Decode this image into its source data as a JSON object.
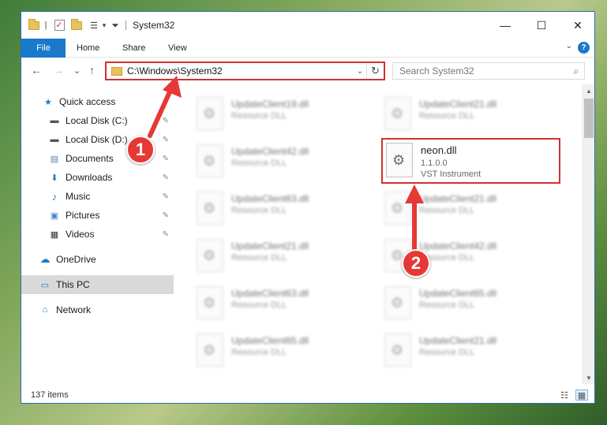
{
  "window": {
    "title": "System32",
    "controls": {
      "minimize": "—",
      "maximize": "☐",
      "close": "✕"
    }
  },
  "quick_access_toolbar": {
    "separator": "|",
    "dropdown": "▾"
  },
  "ribbon": {
    "tabs": [
      "File",
      "Home",
      "Share",
      "View"
    ],
    "expand": "⌄",
    "help": "?"
  },
  "nav_buttons": {
    "back": "←",
    "forward": "→",
    "recent": "⌄",
    "up": "↑"
  },
  "address": {
    "path": "C:\\Windows\\System32",
    "dropdown": "⌄",
    "refresh": "↻"
  },
  "search": {
    "placeholder": "Search System32",
    "icon": "⌕"
  },
  "navigation": {
    "items": [
      {
        "label": "Quick access",
        "icon": "★",
        "pinned": false
      },
      {
        "label": "Local Disk (C:)",
        "icon": "▬",
        "pinned": true
      },
      {
        "label": "Local Disk (D:)",
        "icon": "▬",
        "pinned": true
      },
      {
        "label": "Documents",
        "icon": "▤",
        "pinned": true
      },
      {
        "label": "Downloads",
        "icon": "⬇",
        "pinned": true
      },
      {
        "label": "Music",
        "icon": "♪",
        "pinned": true
      },
      {
        "label": "Pictures",
        "icon": "▣",
        "pinned": true
      },
      {
        "label": "Videos",
        "icon": "▦",
        "pinned": true
      },
      {
        "label": "OneDrive",
        "icon": "☁",
        "pinned": false
      },
      {
        "label": "This PC",
        "icon": "▭",
        "pinned": false,
        "selected": true
      },
      {
        "label": "Network",
        "icon": "⌂",
        "pinned": false
      }
    ],
    "pin_icon": "✎"
  },
  "files": {
    "left_column": [
      {
        "name": "UpdateClient19.dll",
        "desc": "Resource DLL"
      },
      {
        "name": "UpdateClient42.dll",
        "desc": "Resource DLL"
      },
      {
        "name": "UpdateClient63.dll",
        "desc": "Resource DLL"
      },
      {
        "name": "UpdateClient21.dll",
        "desc": "Resource DLL"
      },
      {
        "name": "UpdateClient63.dll",
        "desc": "Resource DLL"
      },
      {
        "name": "UpdateClient65.dll",
        "desc": "Resource DLL"
      }
    ],
    "right_column": [
      {
        "name": "UpdateClient21.dll",
        "desc": "Resource DLL"
      },
      {
        "name": "UpdateClient21.dll",
        "desc": "Resource DLL"
      },
      {
        "name": "UpdateClient42.dll",
        "desc": "Resource DLL"
      },
      {
        "name": "UpdateClient65.dll",
        "desc": "Resource DLL"
      },
      {
        "name": "UpdateClient21.dll",
        "desc": "Resource DLL"
      }
    ],
    "highlighted": {
      "name": "neon.dll",
      "version": "1.1.0.0",
      "desc": "VST Instrument"
    }
  },
  "scrollbar": {
    "up": "▲",
    "down": "▼"
  },
  "status": {
    "item_count": "137 items",
    "details_view": "☷",
    "tiles_view": "▦"
  },
  "annotations": {
    "step1": "1",
    "step2": "2",
    "color": "#e53935"
  }
}
